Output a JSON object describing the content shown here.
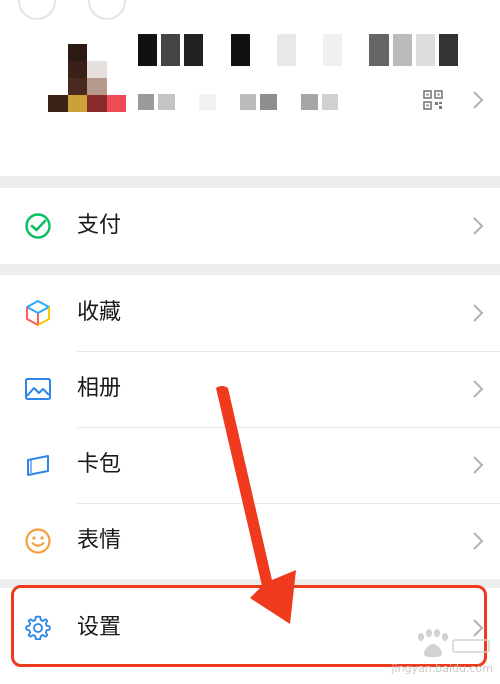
{
  "menu": {
    "pay_label": "支付",
    "favorites_label": "收藏",
    "album_label": "相册",
    "cards_label": "卡包",
    "stickers_label": "表情",
    "settings_label": "设置"
  },
  "icons": {
    "pay": "pay-icon",
    "favorites": "favorites-cube-icon",
    "album": "album-picture-icon",
    "cards": "card-wallet-icon",
    "stickers": "smiley-face-icon",
    "settings": "gear-icon",
    "qr": "qr-code-icon",
    "chevron": "chevron-right-icon"
  },
  "colors": {
    "accent_green": "#07c160",
    "highlight_red": "#ee3b1e",
    "background": "#ededed",
    "text": "#191919"
  },
  "watermark": {
    "url": "jingyan.baidu.com"
  }
}
